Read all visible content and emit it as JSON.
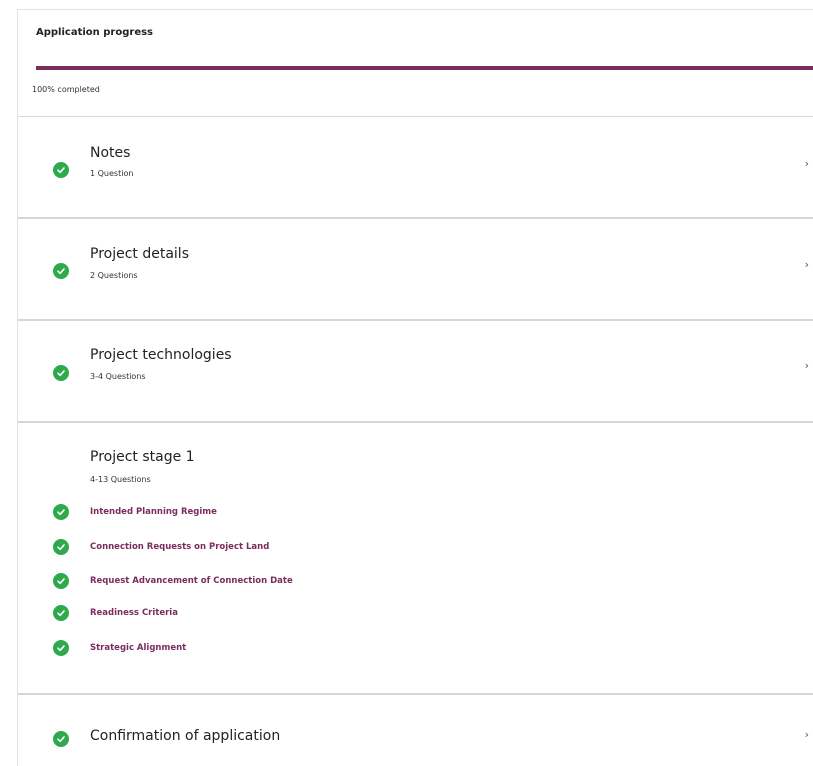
{
  "header": {
    "title": "Application progress",
    "progress_percent": 100,
    "progress_text": "100% completed"
  },
  "sections": [
    {
      "title": "Notes",
      "subtitle": "1 Question",
      "status": "complete",
      "chevron": "›"
    },
    {
      "title": "Project details",
      "subtitle": "2 Questions",
      "status": "complete",
      "chevron": "›"
    },
    {
      "title": "Project technologies",
      "subtitle": "3-4 Questions",
      "status": "complete",
      "chevron": "›"
    },
    {
      "title": "Project stage 1",
      "subtitle": "4-13 Questions",
      "items": [
        {
          "label": "Intended Planning Regime",
          "status": "complete"
        },
        {
          "label": "Connection Requests on Project Land",
          "status": "complete"
        },
        {
          "label": "Request Advancement of Connection Date",
          "status": "complete"
        },
        {
          "label": "Readiness Criteria",
          "status": "complete"
        },
        {
          "label": "Strategic Alignment",
          "status": "complete"
        }
      ]
    },
    {
      "title": "Confirmation of application",
      "status": "complete",
      "chevron": "›"
    }
  ],
  "colors": {
    "accent": "#7a2d5e",
    "success": "#2eaa4d"
  },
  "icons": {
    "complete": "check-circle-icon",
    "chevron": "chevron-right-icon"
  }
}
